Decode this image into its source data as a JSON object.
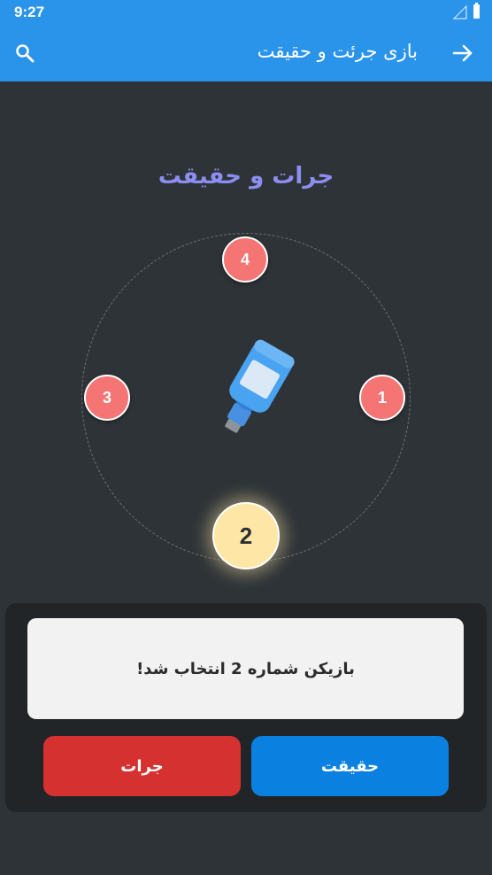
{
  "status_bar": {
    "time": "9:27"
  },
  "app_bar": {
    "title": "بازی جرئت و حقیقت",
    "search_icon": "search-icon",
    "back_icon": "arrow-forward-icon"
  },
  "game": {
    "title": "جرات و حقیقت",
    "players": [
      {
        "number": "1",
        "selected": false
      },
      {
        "number": "2",
        "selected": true
      },
      {
        "number": "3",
        "selected": false
      },
      {
        "number": "4",
        "selected": false
      }
    ],
    "selected_player": "2",
    "bottle_icon": "bottle-icon"
  },
  "result": {
    "message": "بازیکن شماره 2 انتخاب شد!"
  },
  "actions": {
    "dare_label": "جرات",
    "truth_label": "حقیقت"
  },
  "colors": {
    "app_bar": "#2a93ea",
    "background": "#2e3337",
    "title_accent": "#8d8ef2",
    "player": "#f57575",
    "selected_player": "#fde6a6",
    "dare": "#d63131",
    "truth": "#0a80e1"
  }
}
